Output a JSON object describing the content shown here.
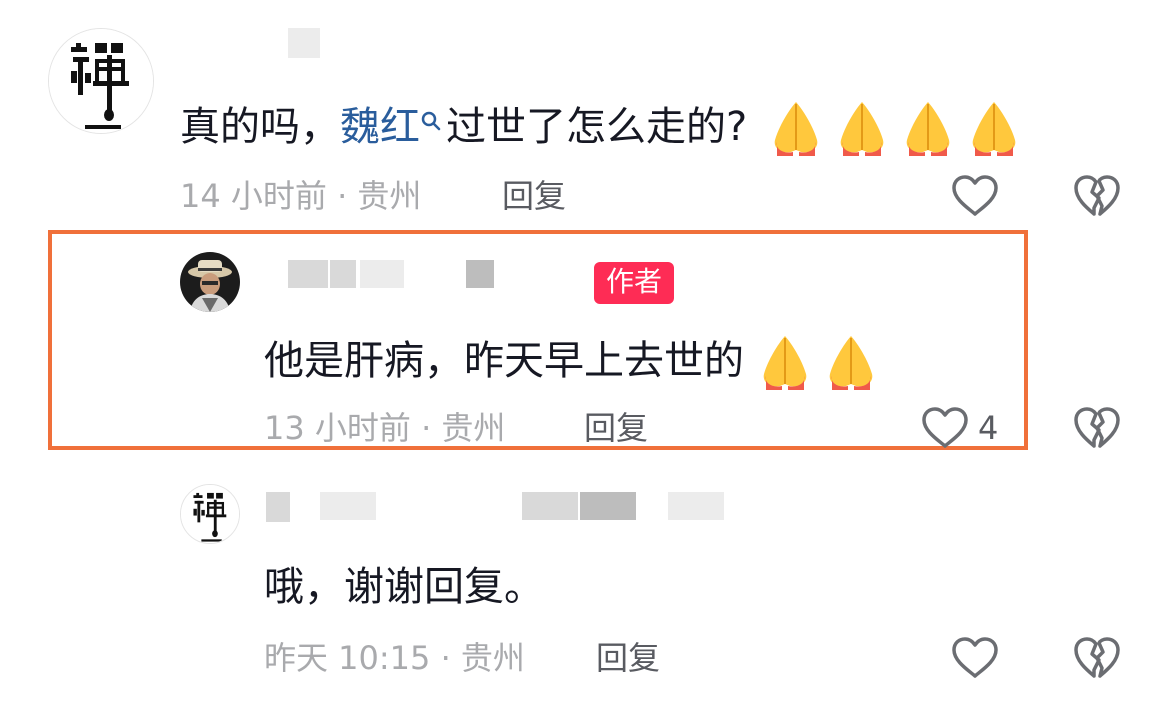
{
  "colors": {
    "highlight_border": "#f0703a",
    "author_badge": "#fe2c55",
    "link": "#2a5d9c",
    "meta_text": "#a9aaad",
    "reply_text": "#595b61"
  },
  "comments": [
    {
      "avatar": "zen-calligraphy-avatar",
      "username_redacted": true,
      "text_before": "真的吗，",
      "link_name": "魏红",
      "text_after": "过世了怎么走的?",
      "emoji_count": 4,
      "emoji_name": "folded-hands-emoji",
      "time_location": "14 小时前 · 贵州",
      "reply_label": "回复",
      "like_count": ""
    },
    {
      "avatar": "man-with-hat-avatar",
      "username_redacted": true,
      "badge": "作者",
      "text": "他是肝病，昨天早上去世的",
      "emoji_count": 2,
      "emoji_name": "folded-hands-emoji",
      "time_location": "13 小时前 · 贵州",
      "reply_label": "回复",
      "like_count": "4",
      "highlighted": true
    },
    {
      "avatar": "zen-calligraphy-avatar",
      "username_redacted": true,
      "text": "哦，谢谢回复。",
      "time_location": "昨天 10:15 · 贵州",
      "reply_label": "回复",
      "like_count": ""
    }
  ]
}
